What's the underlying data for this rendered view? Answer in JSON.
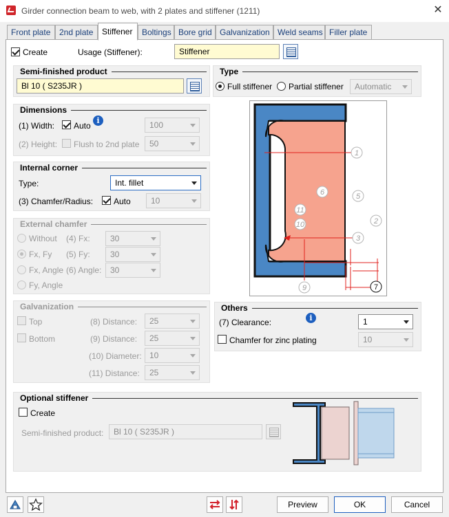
{
  "window": {
    "title": "Girder connection beam to web, with 2 plates and stiffener (1211)"
  },
  "tabs": [
    {
      "label": "Front plate",
      "active": false
    },
    {
      "label": "2nd plate",
      "active": false
    },
    {
      "label": "Stiffener",
      "active": true
    },
    {
      "label": "Boltings",
      "active": false
    },
    {
      "label": "Bore grid",
      "active": false
    },
    {
      "label": "Galvanization",
      "active": false
    },
    {
      "label": "Weld seams",
      "active": false
    },
    {
      "label": "Filler plate",
      "active": false
    }
  ],
  "top": {
    "create_label": "Create",
    "create_checked": true,
    "usage_label": "Usage (Stiffener):",
    "usage_value": "Stiffener"
  },
  "semi_finished": {
    "title": "Semi-finished product",
    "value": "Bl 10  ( S235JR )"
  },
  "type": {
    "title": "Type",
    "full_label": "Full stiffener",
    "partial_label": "Partial stiffener",
    "combo_value": "Automatic"
  },
  "dimensions": {
    "title": "Dimensions",
    "width_label": "(1) Width:",
    "width_auto_label": "Auto",
    "width_value": "100",
    "height_label": "(2) Height:",
    "height_flush_label": "Flush to 2nd plate",
    "height_value": "50"
  },
  "internal_corner": {
    "title": "Internal corner",
    "type_label": "Type:",
    "type_value": "Int. fillet",
    "chamfer_label": "(3) Chamfer/Radius:",
    "auto_label": "Auto",
    "value": "10"
  },
  "external_chamfer": {
    "title": "External chamfer",
    "without_label": "Without",
    "fxfy_label": "Fx, Fy",
    "fxangle_label": "Fx, Angle",
    "fyangle_label": "Fy, Angle",
    "fx_label": "(4) Fx:",
    "fx_value": "30",
    "fy_label": "(5) Fy:",
    "fy_value": "30",
    "angle_label": "(6) Angle:",
    "angle_value": "30"
  },
  "galvanization": {
    "title": "Galvanization",
    "top_label": "Top",
    "bottom_label": "Bottom",
    "d8_label": "(8) Distance:",
    "d8_value": "25",
    "d9_label": "(9) Distance:",
    "d9_value": "25",
    "d10_label": "(10) Diameter:",
    "d10_value": "10",
    "d11_label": "(11) Distance:",
    "d11_value": "25"
  },
  "others": {
    "title": "Others",
    "clearance_label": "(7) Clearance:",
    "clearance_value": "1",
    "zinc_label": "Chamfer for zinc plating",
    "zinc_value": "10"
  },
  "optional_stiffener": {
    "title": "Optional stiffener",
    "create_label": "Create",
    "semi_label": "Semi-finished product:",
    "semi_value": "Bl 10  ( S235JR )"
  },
  "diagram": {
    "markers": [
      "1",
      "2",
      "3",
      "5",
      "6",
      "7",
      "9",
      "10",
      "11"
    ]
  },
  "footer": {
    "preview": "Preview",
    "ok": "OK",
    "cancel": "Cancel"
  },
  "colors": {
    "accent": "#1d5fbf",
    "stiffener_fill": "#f6a38e",
    "steel": "#4a87c5",
    "dim_line": "#e0201c",
    "field_yellow": "#fffbd2"
  }
}
